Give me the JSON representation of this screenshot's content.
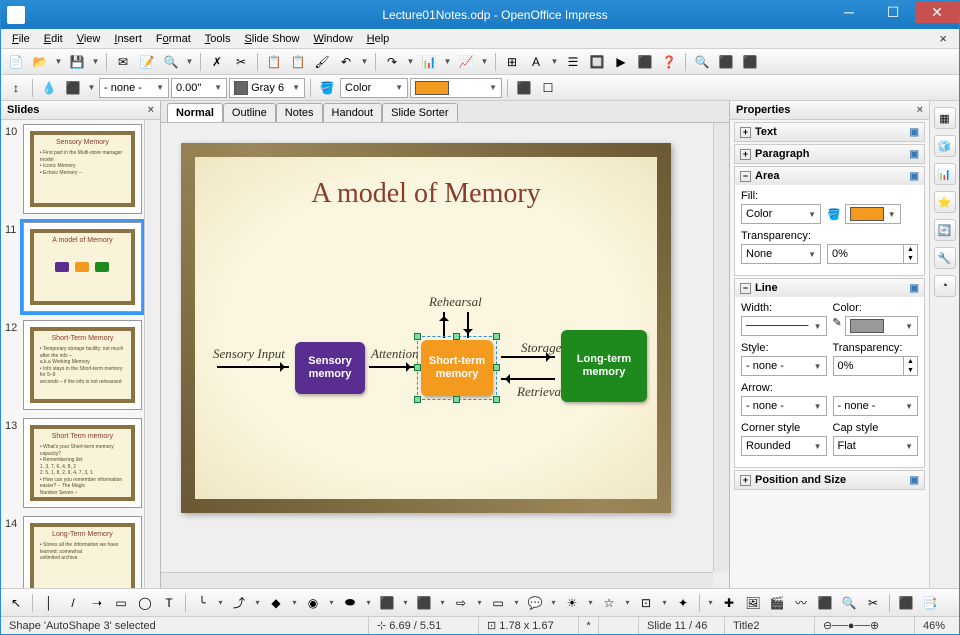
{
  "window": {
    "title": "Lecture01Notes.odp - OpenOffice Impress",
    "min": "─",
    "max": "☐",
    "close": "✕"
  },
  "menu": {
    "file": "File",
    "edit": "Edit",
    "view": "View",
    "insert": "Insert",
    "format": "Format",
    "tools": "Tools",
    "slideshow": "Slide Show",
    "window": "Window",
    "help": "Help",
    "close_doc": "×"
  },
  "toolbar1_icons": [
    "📄",
    "📂",
    "💾",
    "✉",
    "📝",
    "🔍",
    "✗",
    "✂",
    "📋",
    "📋",
    "🖌",
    "↶",
    "↷",
    "📊",
    "📈",
    "⊞",
    "A",
    "☰",
    "🔲",
    "▶",
    "⬛",
    "❓",
    "🔍",
    "⬛",
    "⬛"
  ],
  "toolbar2": {
    "lead_icons": [
      "↕",
      "💧",
      "⬛"
    ],
    "line_style": "- none -",
    "line_width": "0.00\"",
    "line_color_label": "Gray 6",
    "fill_bucket": "🪣",
    "fill_type": "Color",
    "fill_swatch_hex": "#f39a1f",
    "tail_icons": [
      "⬛",
      "☐"
    ]
  },
  "slides_panel": {
    "title": "Slides",
    "thumbs": [
      {
        "num": "10",
        "title": "Sensory Memory",
        "body": [
          "• First part in the Multi-store manager model",
          "• Iconic Memory",
          "• Echoic Memory –"
        ]
      },
      {
        "num": "11",
        "title": "A model of Memory",
        "boxes": true,
        "selected": true
      },
      {
        "num": "12",
        "title": "Short-Term Memory",
        "body": [
          "• Temporary storage facility; not much after the info –",
          "   a.k.a Working Memory",
          "• Info stays in the Short-term memory for 5–9",
          "   seconds – if the info is not rehearsed"
        ]
      },
      {
        "num": "13",
        "title": "Short Term memory",
        "body": [
          "• What's your Short-term memory capacity?",
          "• Remembering list:",
          "   1. 3, 7, 6, 4, 8, 2",
          "   2. 5, 1, 8, 2, 9, 4, 7, 3, 1",
          "• How can you remember information easier? – The Magic",
          "   Number Seven –"
        ]
      },
      {
        "num": "14",
        "title": "Long-Term Memory",
        "body": [
          "• Stores all the information we have learned; somewhat",
          "   unlimited archive"
        ]
      }
    ]
  },
  "view_tabs": [
    "Normal",
    "Outline",
    "Notes",
    "Handout",
    "Slide Sorter"
  ],
  "active_view_tab": 0,
  "slide": {
    "title": "A model of Memory",
    "labels": {
      "sensory_input": "Sensory Input",
      "attention": "Attention",
      "rehearsal": "Rehearsal",
      "storage": "Storage",
      "retrieval": "Retrieval"
    },
    "boxes": {
      "sensory": "Sensory\nmemory",
      "short": "Short-term\nmemory",
      "long": "Long-term\nmemory"
    },
    "colors": {
      "sensory": "#5a2e91",
      "short": "#f39a1f",
      "long": "#1e8a1e"
    }
  },
  "properties": {
    "title": "Properties",
    "sections": {
      "text": "Text",
      "paragraph": "Paragraph",
      "area": {
        "title": "Area",
        "fill_label": "Fill:",
        "fill_type": "Color",
        "fill_swatch": "#f39a1f",
        "transparency_label": "Transparency:",
        "transparency_type": "None",
        "transparency_val": "0%"
      },
      "line": {
        "title": "Line",
        "width_label": "Width:",
        "width_val": "────────",
        "color_label": "Color:",
        "color_swatch": "#999999",
        "style_label": "Style:",
        "style_val": "- none -",
        "transparency_label": "Transparency:",
        "transparency_val": "0%",
        "arrow_label": "Arrow:",
        "arrow_left": "- none -",
        "arrow_right": "- none -",
        "corner_label": "Corner style",
        "corner_val": "Rounded",
        "cap_label": "Cap style",
        "cap_val": "Flat"
      },
      "pos": "Position and Size"
    }
  },
  "sidetool_icons": [
    "▦",
    "🧊",
    "📊",
    "⭐",
    "🔄",
    "🔧",
    "◔"
  ],
  "drawbar_icons": [
    "↖",
    "│",
    "/",
    "➝",
    "▭",
    "◯",
    "T",
    "╰",
    "⤴",
    "◆",
    "◉",
    "⬬",
    "⬛",
    "⬛",
    "⇨",
    "▭",
    "💬",
    "☀",
    "☆",
    "⊡",
    "✦",
    "✚",
    "🖼",
    "🎬",
    "〰",
    "⬛",
    "🔍",
    "✂",
    "⬛",
    "📑"
  ],
  "status": {
    "selection": "Shape 'AutoShape 3' selected",
    "pos": "⊹ 6.69 / 5.51",
    "size": "⊡ 1.78 x 1.67",
    "modified": "*",
    "slide_count": "Slide 11 / 46",
    "template": "Title2",
    "zoom_ctrl": "⊖──●──⊕",
    "zoom": "46%"
  }
}
